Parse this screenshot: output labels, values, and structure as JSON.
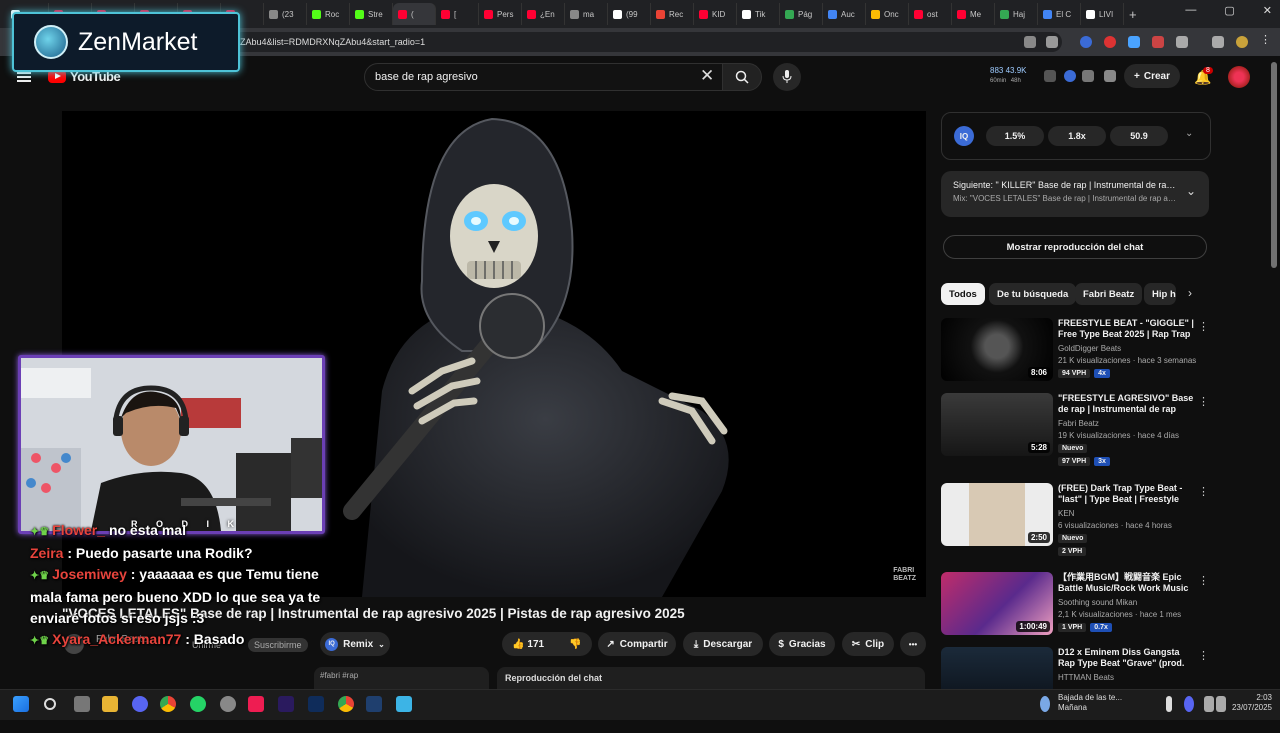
{
  "browser": {
    "tabs": [
      {
        "label": "",
        "color": "#ffffff"
      },
      {
        "label": "",
        "color": "#ff0033"
      },
      {
        "label": "",
        "color": "#ff0033"
      },
      {
        "label": "",
        "color": "#ff0033"
      },
      {
        "label": "",
        "color": "#ff0033"
      },
      {
        "label": "",
        "color": "#ff0033"
      },
      {
        "label": "(23",
        "color": "#888888"
      },
      {
        "label": "Roc",
        "color": "#53fc18"
      },
      {
        "label": "Stre",
        "color": "#53fc18"
      },
      {
        "label": "(",
        "color": "#ff0033"
      },
      {
        "label": "[",
        "color": "#ff0033"
      },
      {
        "label": "Pers",
        "color": "#ff0033"
      },
      {
        "label": "¿En",
        "color": "#ff0033"
      },
      {
        "label": "ma",
        "color": "#888888"
      },
      {
        "label": "(99",
        "color": "#ffffff"
      },
      {
        "label": "Rec",
        "color": "#ea4335"
      },
      {
        "label": "KID",
        "color": "#ff0033"
      },
      {
        "label": "Tik",
        "color": "#ffffff"
      },
      {
        "label": "Pág",
        "color": "#34a853"
      },
      {
        "label": "Auc",
        "color": "#4285f4"
      },
      {
        "label": "Onc",
        "color": "#fbbc04"
      },
      {
        "label": "ost",
        "color": "#ff0033"
      },
      {
        "label": "Me",
        "color": "#ff0033"
      },
      {
        "label": "Haj",
        "color": "#34a853"
      },
      {
        "label": "El C",
        "color": "#4285f4"
      },
      {
        "label": "LIVI",
        "color": "#ffffff"
      }
    ],
    "new_tab": "+",
    "window_controls": [
      "—",
      "▢",
      "✕"
    ],
    "url": "ZAbu4&list=RDMDRXNqZAbu4&start_radio=1"
  },
  "overlay_brand": {
    "name": "ZenMarket"
  },
  "youtube": {
    "logo_text": "YouTube",
    "search": {
      "value": "base de rap agresivo"
    },
    "stats": {
      "a": "883",
      "a_sub": "60min",
      "b": "43.9K",
      "b_sub": "48h"
    },
    "create_label": "Crear",
    "notifications_count": "8"
  },
  "video": {
    "watermark": "FABRI\nBEATZ",
    "title": "\"VOCES LETALES\" Base de rap | Instrumental de rap agresivo 2025 | Pistas de rap agresivo 2025",
    "channel": "Fabri Beatz",
    "join_label": "Unirme",
    "subscribe_label": "Suscribirme",
    "remix_label": "Remix",
    "likes": "171",
    "share_label": "Compartir",
    "download_label": "Descargar",
    "thanks_label": "Gracias",
    "clip_label": "Clip",
    "more_label": "•••",
    "tags": "#fabri #rap",
    "replay_chat_label": "Reproducción del chat"
  },
  "iq_panel": {
    "badge": "IQ",
    "values": [
      "1.5%",
      "1.8x",
      "50.9"
    ]
  },
  "up_next": {
    "title": "Siguiente: \" KILLER\" Base de rap | Instrumental de rap agresivo",
    "mix": "Mix: \"VOCES LETALES\" Base de rap | Instrumental de rap agresivo"
  },
  "show_chat_label": "Mostrar reproducción del chat",
  "chips": [
    "Todos",
    "De tu búsqueda",
    "Fabri Beatz",
    "Hip h"
  ],
  "recommendations": [
    {
      "title": "FREESTYLE BEAT - \"GIGGLE\" | Free Type Beat 2025 | Rap Trap",
      "channel": "GoldDigger Beats",
      "meta": "21 K visualizaciones · hace 3 semanas",
      "duration": "8:06",
      "badge1": "94 VPH",
      "badge2": "4x",
      "new": ""
    },
    {
      "title": "\"FREESTYLE AGRESIVO\" Base de rap | Instrumental de rap agresivo",
      "channel": "Fabri Beatz",
      "meta": "19 K visualizaciones · hace 4 días",
      "duration": "5:28",
      "badge1": "97 VPH",
      "badge2": "3x",
      "new": "Nuevo"
    },
    {
      "title": "(FREE) Dark Trap Type Beat - \"last\" | Type Beat | Freestyle",
      "channel": "KEN",
      "meta": "6 visualizaciones · hace 4 horas",
      "duration": "2:50",
      "badge1": "2 VPH",
      "badge2": "",
      "new": "Nuevo"
    },
    {
      "title": "【作業用BGM】戦闘音楽 Epic Battle Music/Rock Work Music",
      "channel": "Soothing sound Mikan",
      "meta": "2,1 K visualizaciones · hace 1 mes",
      "duration": "1:00:49",
      "badge1": "1 VPH",
      "badge2": "0.7x",
      "new": ""
    },
    {
      "title": "D12 x Eminem Diss Gangsta Rap Type Beat \"Grave\" (prod.",
      "channel": "HTTMAN Beats",
      "meta": "",
      "duration": "",
      "badge1": "",
      "badge2": "",
      "new": ""
    }
  ],
  "webcam": {
    "overlay_text": "R O D I K"
  },
  "chat": [
    {
      "user": "Flower_",
      "text": "no esta mal",
      "crown": true
    },
    {
      "user": "Zeira",
      "text": ": Puedo pasarte una Rodik?",
      "crown": false
    },
    {
      "user": "Josemiwey",
      "text": ": yaaaaaa es que Temu tiene mala fama pero bueno XDD lo que sea ya te enviaré fotos si eso jsjs :3",
      "crown": true
    },
    {
      "user": "Xyara_Ackerman77",
      "text": ": Basado",
      "crown": true
    }
  ],
  "taskbar": {
    "weather_line1": "Bajada de las te...",
    "weather_line2": "Mañana",
    "time": "2:03",
    "date": "23/07/2025"
  }
}
